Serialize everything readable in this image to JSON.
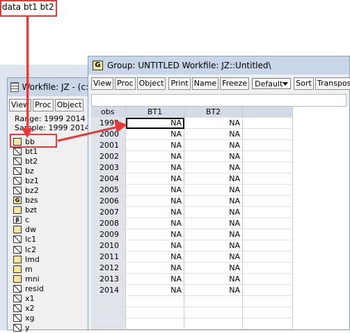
{
  "command": "data bt1 bt2",
  "workfile_window": {
    "title": "Workfile: JZ - (c:",
    "toolbar": [
      "View",
      "Proc",
      "Object"
    ],
    "range_label": "Range:",
    "range_value": "1999 2014",
    "sample_label": "Sample:",
    "sample_value": "1999 2014",
    "objects": [
      {
        "name": "bb",
        "icon": "group-icon"
      },
      {
        "name": "bt1",
        "icon": "series-icon"
      },
      {
        "name": "bt2",
        "icon": "series-icon"
      },
      {
        "name": "bz",
        "icon": "series-icon"
      },
      {
        "name": "bz1",
        "icon": "series-icon"
      },
      {
        "name": "bz2",
        "icon": "series-icon"
      },
      {
        "name": "bzs",
        "icon": "group-icon"
      },
      {
        "name": "bzt",
        "icon": "group-icon"
      },
      {
        "name": "c",
        "icon": "coef-icon"
      },
      {
        "name": "dw",
        "icon": "group-icon"
      },
      {
        "name": "lc1",
        "icon": "series-icon"
      },
      {
        "name": "lc2",
        "icon": "series-icon"
      },
      {
        "name": "lmd",
        "icon": "group-icon"
      },
      {
        "name": "m",
        "icon": "group-icon"
      },
      {
        "name": "mni",
        "icon": "group-icon"
      },
      {
        "name": "resid",
        "icon": "series-icon"
      },
      {
        "name": "x1",
        "icon": "series-icon"
      },
      {
        "name": "x2",
        "icon": "series-icon"
      },
      {
        "name": "xg",
        "icon": "series-icon"
      },
      {
        "name": "y",
        "icon": "series-icon"
      }
    ]
  },
  "group_window": {
    "title": "Group: UNTITLED   Workfile: JZ::Untitled\\",
    "icon_letter": "G",
    "toolbar": [
      "View",
      "Proc",
      "Object",
      "Print",
      "Name",
      "Freeze"
    ],
    "dropdown_value": "Default",
    "toolbar_right": [
      "Sort",
      "Transpose"
    ],
    "headers": [
      "obs",
      "BT1",
      "BT2"
    ],
    "rows": [
      {
        "obs": "1999",
        "bt1": "NA",
        "bt2": "NA"
      },
      {
        "obs": "2000",
        "bt1": "NA",
        "bt2": "NA"
      },
      {
        "obs": "2001",
        "bt1": "NA",
        "bt2": "NA"
      },
      {
        "obs": "2002",
        "bt1": "NA",
        "bt2": "NA"
      },
      {
        "obs": "2003",
        "bt1": "NA",
        "bt2": "NA"
      },
      {
        "obs": "2004",
        "bt1": "NA",
        "bt2": "NA"
      },
      {
        "obs": "2005",
        "bt1": "NA",
        "bt2": "NA"
      },
      {
        "obs": "2006",
        "bt1": "NA",
        "bt2": "NA"
      },
      {
        "obs": "2007",
        "bt1": "NA",
        "bt2": "NA"
      },
      {
        "obs": "2008",
        "bt1": "NA",
        "bt2": "NA"
      },
      {
        "obs": "2009",
        "bt1": "NA",
        "bt2": "NA"
      },
      {
        "obs": "2010",
        "bt1": "NA",
        "bt2": "NA"
      },
      {
        "obs": "2011",
        "bt1": "NA",
        "bt2": "NA"
      },
      {
        "obs": "2012",
        "bt1": "NA",
        "bt2": "NA"
      },
      {
        "obs": "2013",
        "bt1": "NA",
        "bt2": "NA"
      },
      {
        "obs": "2014",
        "bt1": "NA",
        "bt2": "NA"
      }
    ]
  },
  "colors": {
    "annotation": "#e8383a",
    "titlebar": "#c8d6e8"
  }
}
